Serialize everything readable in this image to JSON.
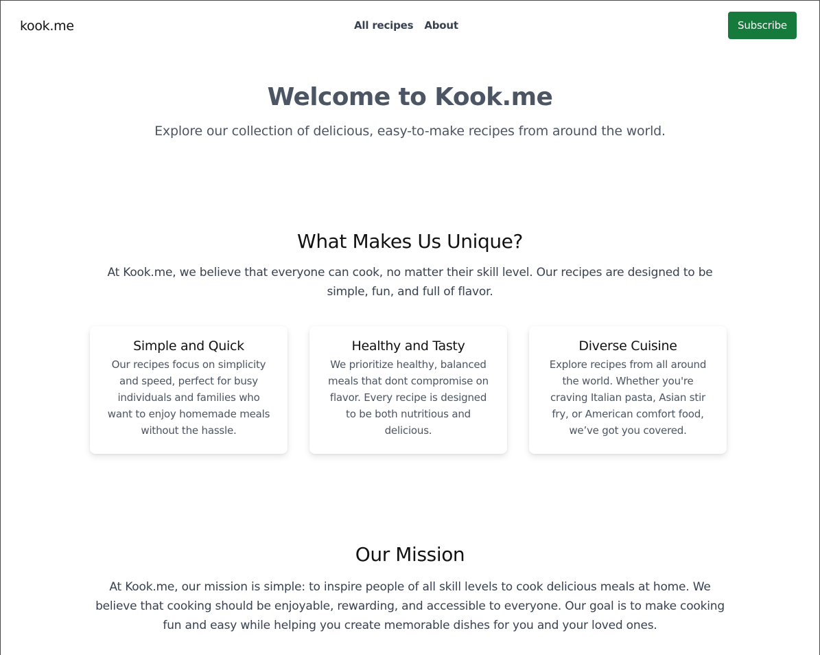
{
  "nav": {
    "logo": "kook.me",
    "links": [
      "All recipes",
      "About"
    ],
    "subscribe_label": "Subscribe"
  },
  "hero": {
    "title": "Welcome to Kook.me",
    "subtitle": "Explore our collection of delicious, easy-to-make recipes from around the world."
  },
  "unique": {
    "title": "What Makes Us Unique?",
    "intro": "At Kook.me, we believe that everyone can cook, no matter their skill level. Our recipes are designed to be simple, fun, and full of flavor.",
    "cards": [
      {
        "title": "Simple and Quick",
        "text": "Our recipes focus on simplicity and speed, perfect for busy individuals and families who want to enjoy homemade meals without the hassle."
      },
      {
        "title": "Healthy and Tasty",
        "text": "We prioritize healthy, balanced meals that dont compromise on flavor. Every recipe is designed to be both nutritious and delicious."
      },
      {
        "title": "Diverse Cuisine",
        "text": "Explore recipes from all around the world. Whether you're craving Italian pasta, Asian stir fry, or American comfort food, we’ve got you covered."
      }
    ]
  },
  "mission": {
    "title": "Our Mission",
    "text": "At Kook.me, our mission is simple: to inspire people of all skill levels to cook delicious meals at home. We believe that cooking should be enjoyable, rewarding, and accessible to everyone. Our goal is to make cooking fun and easy while helping you create memorable dishes for you and your loved ones."
  },
  "colors": {
    "accent": "#157a3b",
    "heading_gray": "#4b5563"
  }
}
